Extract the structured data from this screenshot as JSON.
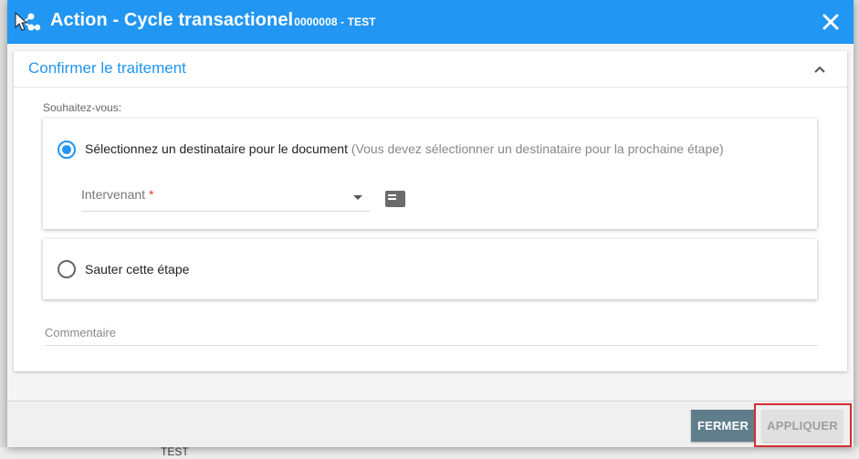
{
  "dialog": {
    "title": "Action - Cycle transactionel",
    "title_sub": "0000008 - TEST",
    "icon": "workflow-icon",
    "close_icon": "close-icon"
  },
  "panel": {
    "title": "Confirmer le traitement",
    "collapse_icon": "chevron-up-icon",
    "prompt": "Souhaitez-vous:"
  },
  "options": [
    {
      "label": "Sélectionnez un destinataire pour le document",
      "hint": "(Vous devez sélectionner un destinataire pour la prochaine étape)",
      "selected": true
    },
    {
      "label": "Sauter cette étape",
      "selected": false
    }
  ],
  "intervenant": {
    "label": "Intervenant",
    "required_mark": "*",
    "value": ""
  },
  "comment": {
    "label": "Commentaire",
    "value": ""
  },
  "footer": {
    "close_label": "FERMER",
    "apply_label": "APPLIQUER"
  },
  "background": {
    "fragment_text": "TEST"
  },
  "colors": {
    "primary": "#2196f3",
    "close_button": "#607d8b",
    "apply_disabled": "#e0e0e0",
    "highlight": "#d32f2f",
    "required": "#e53935"
  }
}
